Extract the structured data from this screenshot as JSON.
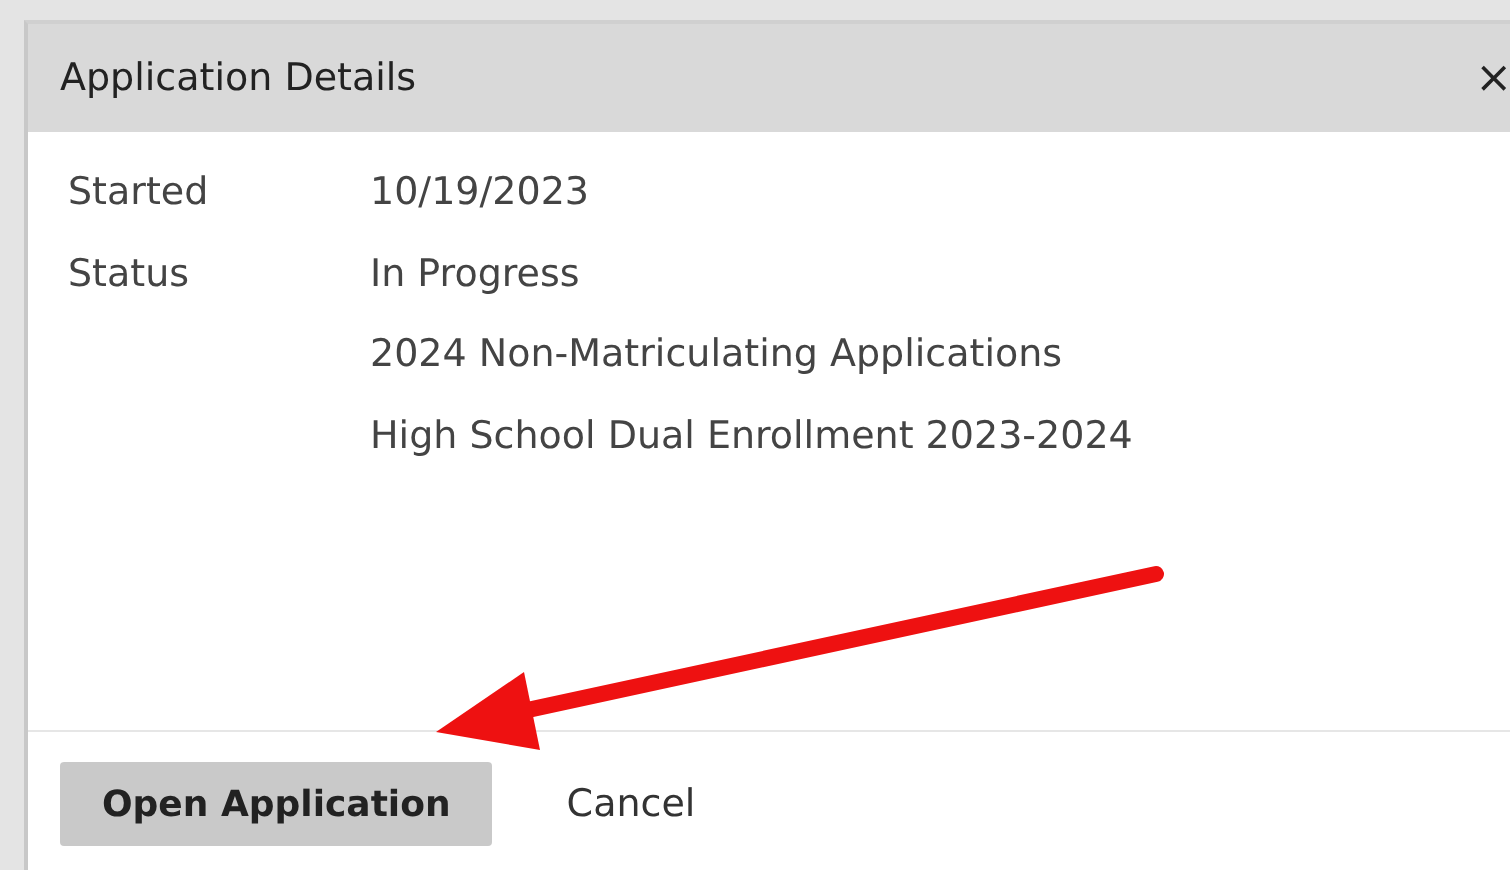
{
  "dialog": {
    "title": "Application Details",
    "close": "×",
    "details": [
      {
        "label": "Started",
        "value": "10/19/2023"
      },
      {
        "label": "Status",
        "value": "In Progress"
      },
      {
        "value": "2024 Non-Matriculating Applications"
      },
      {
        "value": "High School Dual Enrollment 2023-2024"
      }
    ],
    "buttons": [
      {
        "label": "Open Application",
        "kind": "primary"
      },
      {
        "label": "Cancel",
        "kind": "plain"
      }
    ]
  }
}
